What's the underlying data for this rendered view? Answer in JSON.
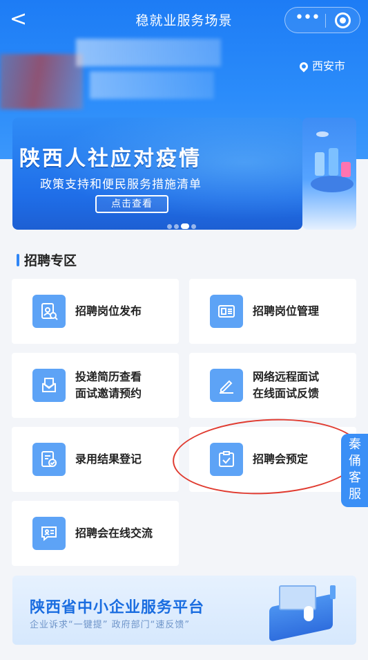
{
  "nav": {
    "back_glyph": "<",
    "title": "稳就业服务场景",
    "more_glyph": "•••"
  },
  "header": {
    "location": "西安市"
  },
  "banner": {
    "headline": "陕西人社应对疫情",
    "subtitle": "政策支持和便民服务措施清单",
    "button_label": "点击查看",
    "pages": 4,
    "active_page": 3
  },
  "section": {
    "title": "招聘专区"
  },
  "cards": [
    {
      "lines": [
        "招聘岗位发布"
      ],
      "icon": "resume-search-icon"
    },
    {
      "lines": [
        "招聘岗位管理"
      ],
      "icon": "id-card-icon"
    },
    {
      "lines": [
        "投递简历查看",
        "面试邀请预约"
      ],
      "icon": "envelope-icon"
    },
    {
      "lines": [
        "网络远程面试",
        "在线面试反馈"
      ],
      "icon": "pencil-icon"
    },
    {
      "lines": [
        "录用结果登记"
      ],
      "icon": "document-check-icon"
    },
    {
      "lines": [
        "招聘会预定"
      ],
      "icon": "clipboard-check-icon"
    },
    {
      "lines": [
        "招聘会在线交流"
      ],
      "icon": "chat-icon"
    }
  ],
  "side_tab": {
    "chars": [
      "秦",
      "俑",
      "客",
      "服"
    ]
  },
  "promo": {
    "title": "陕西省中小企业服务平台",
    "subtitle": "企业诉求“一键提” 政府部门“速反馈”"
  },
  "colors": {
    "primary": "#2b8cfa",
    "icon_tile": "#5da3f6",
    "annotation": "#e03b30"
  }
}
